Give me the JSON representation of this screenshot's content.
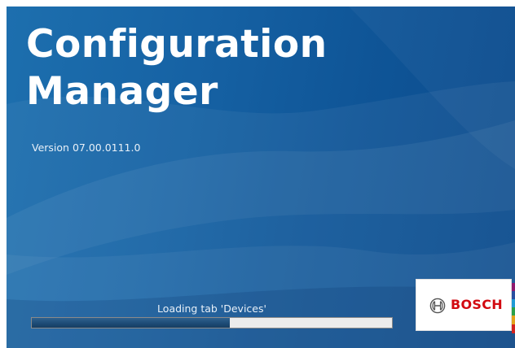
{
  "app": {
    "title_line1": "Configuration",
    "title_line2": "Manager",
    "version": "Version 07.00.0111.0"
  },
  "loading": {
    "status_text": "Loading tab 'Devices'",
    "progress_fraction": 0.55
  },
  "brand": {
    "name": "BOSCH",
    "color": "#d20a11"
  },
  "colors": {
    "background_primary": "#1662a4",
    "progress_fill": "#1c4a74",
    "progress_track": "#ececec"
  }
}
